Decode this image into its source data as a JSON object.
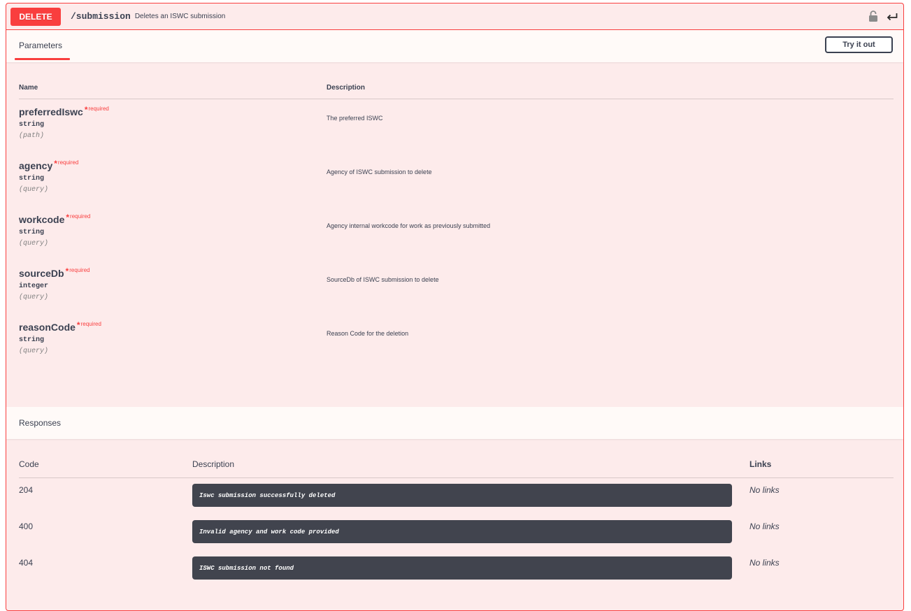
{
  "operation": {
    "method": "DELETE",
    "path": "/submission",
    "summary": "Deletes an ISWC submission",
    "icons": [
      "lock-icon",
      "return-icon"
    ]
  },
  "parameters": {
    "tab_label": "Parameters",
    "try_button_label": "Try it out",
    "col_name": "Name",
    "col_description": "Description",
    "required_star": "*",
    "required_label": "required",
    "items": [
      {
        "name": "preferredIswc",
        "type": "string",
        "in": "(path)",
        "description": "The preferred ISWC"
      },
      {
        "name": "agency",
        "type": "string",
        "in": "(query)",
        "description": "Agency of ISWC submission to delete"
      },
      {
        "name": "workcode",
        "type": "string",
        "in": "(query)",
        "description": "Agency internal workcode for work as previously submitted"
      },
      {
        "name": "sourceDb",
        "type": "integer",
        "in": "(query)",
        "description": "SourceDb of ISWC submission to delete"
      },
      {
        "name": "reasonCode",
        "type": "string",
        "in": "(query)",
        "description": "Reason Code for the deletion"
      }
    ]
  },
  "responses": {
    "title": "Responses",
    "col_code": "Code",
    "col_description": "Description",
    "col_links": "Links",
    "items": [
      {
        "code": "204",
        "description": "Iswc submission successfully deleted",
        "links": "No links"
      },
      {
        "code": "400",
        "description": "Invalid agency and work code provided",
        "links": "No links"
      },
      {
        "code": "404",
        "description": "ISWC submission not found",
        "links": "No links"
      }
    ]
  },
  "colors": {
    "delete_red": "#f93e3e",
    "block_bg": "#fdebeb",
    "header_bg": "#fffaf8",
    "text": "#3b4151",
    "code_bg": "#41444e"
  }
}
